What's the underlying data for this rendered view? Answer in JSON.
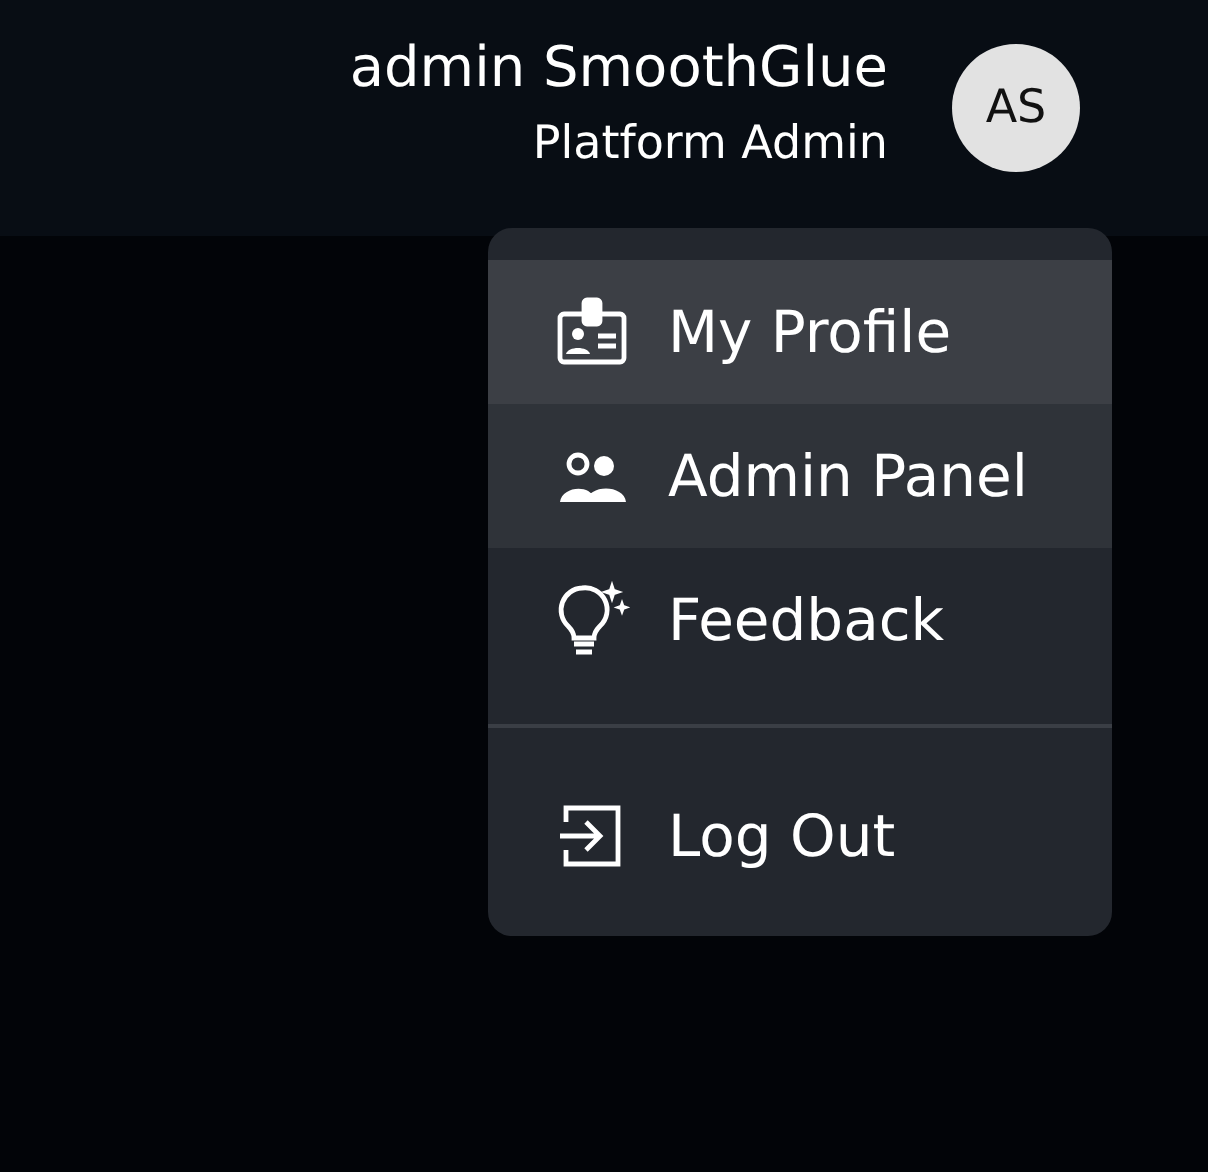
{
  "header": {
    "user_name": "admin SmoothGlue",
    "user_role": "Platform Admin",
    "avatar_initials": "AS"
  },
  "menu": {
    "sections": [
      {
        "items": [
          {
            "kind": "profile",
            "label": "My Profile",
            "hovered": true,
            "selected": false
          },
          {
            "kind": "users",
            "label": "Admin Panel",
            "hovered": false,
            "selected": true
          },
          {
            "kind": "idea",
            "label": "Feedback",
            "hovered": false,
            "selected": false
          }
        ]
      },
      {
        "items": [
          {
            "kind": "logout",
            "label": "Log Out",
            "hovered": false,
            "selected": false
          }
        ]
      }
    ]
  }
}
